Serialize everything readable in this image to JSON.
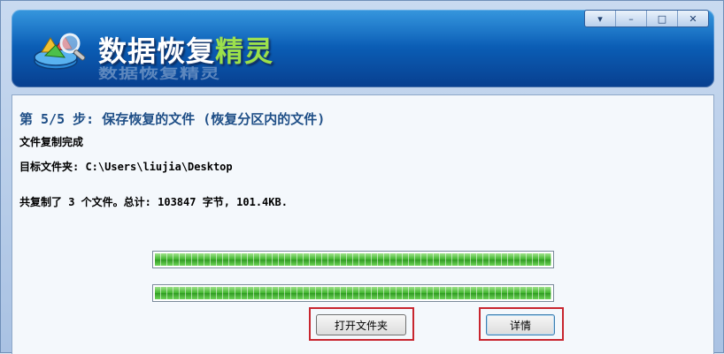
{
  "app": {
    "title_main": "数据恢复",
    "title_accent": "精灵"
  },
  "window_controls": {
    "menu": "▾",
    "minimize": "–",
    "maximize": "□",
    "close": "✕"
  },
  "step": {
    "title": "第 5/5 步: 保存恢复的文件 (恢复分区内的文件)",
    "status": "文件复制完成",
    "folder_line": "目标文件夹: C:\\Users\\liujia\\Desktop",
    "summary_line": "共复制了 3 个文件。总计: 103847 字节, 101.4KB."
  },
  "progress": {
    "overall": 1.0,
    "current": 1.0
  },
  "buttons": {
    "open_folder": "打开文件夹",
    "details": "详情"
  },
  "colors": {
    "header": "#0b5fb7",
    "progress": "#3fb52c",
    "highlight": "#c8262f"
  }
}
